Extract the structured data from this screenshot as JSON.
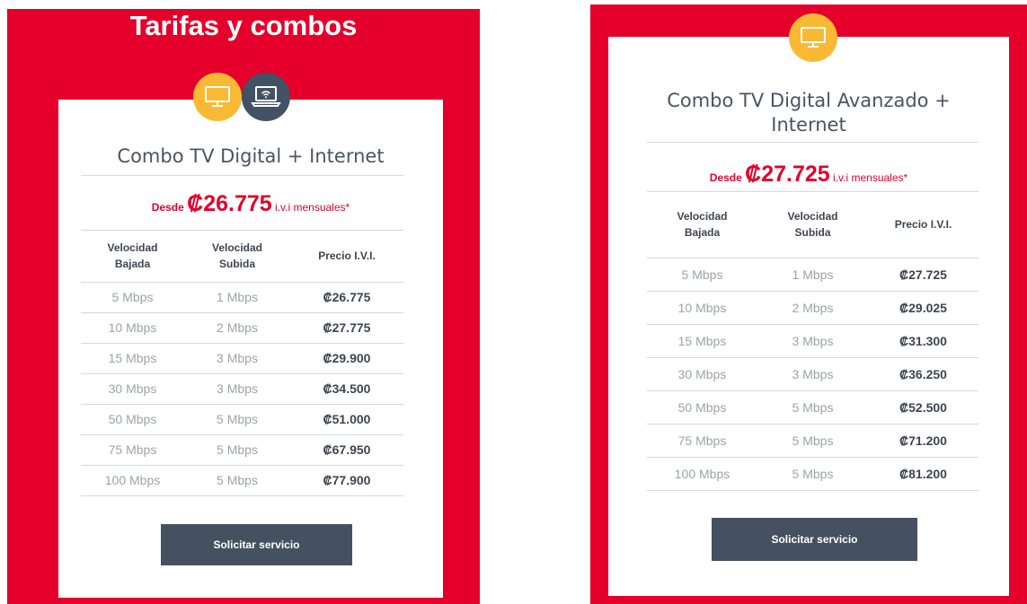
{
  "left": {
    "heading": "Tarifas y combos",
    "icons": [
      "tv-icon",
      "laptop-wifi-icon"
    ],
    "title": "Combo TV Digital + Internet",
    "price": {
      "prefix": "Desde",
      "amount": "₡26.775",
      "suffix": "i.v.i mensuales*"
    },
    "headers": {
      "down_1": "Velocidad",
      "down_2": "Bajada",
      "up_1": "Velocidad",
      "up_2": "Subida",
      "price": "Precio I.V.I."
    },
    "rows": [
      {
        "down": "5 Mbps",
        "up": "1 Mbps",
        "price": "₡26.775"
      },
      {
        "down": "10 Mbps",
        "up": "2 Mbps",
        "price": "₡27.775"
      },
      {
        "down": "15 Mbps",
        "up": "3 Mbps",
        "price": "₡29.900"
      },
      {
        "down": "30 Mbps",
        "up": "3 Mbps",
        "price": "₡34.500"
      },
      {
        "down": "50 Mbps",
        "up": "5 Mbps",
        "price": "₡51.000"
      },
      {
        "down": "75 Mbps",
        "up": "5 Mbps",
        "price": "₡67.950"
      },
      {
        "down": "100 Mbps",
        "up": "5 Mbps",
        "price": "₡77.900"
      }
    ],
    "button": "Solicitar servicio"
  },
  "right": {
    "icons": [
      "tv-icon"
    ],
    "title_line1": "Combo TV Digital Avanzado +",
    "title_line2": "Internet",
    "price": {
      "prefix": "Desde",
      "amount": "₡27.725",
      "suffix": "i.v.i mensuales*"
    },
    "headers": {
      "down_1": "Velocidad",
      "down_2": "Bajada",
      "up_1": "Velocidad",
      "up_2": "Subida",
      "price": "Precio I.V.I."
    },
    "rows": [
      {
        "down": "5 Mbps",
        "up": "1 Mbps",
        "price": "₡27.725"
      },
      {
        "down": "10 Mbps",
        "up": "2 Mbps",
        "price": "₡29.025"
      },
      {
        "down": "15 Mbps",
        "up": "3 Mbps",
        "price": "₡31.300"
      },
      {
        "down": "30 Mbps",
        "up": "3 Mbps",
        "price": "₡36.250"
      },
      {
        "down": "50 Mbps",
        "up": "5 Mbps",
        "price": "₡52.500"
      },
      {
        "down": "75 Mbps",
        "up": "5 Mbps",
        "price": "₡71.200"
      },
      {
        "down": "100 Mbps",
        "up": "5 Mbps",
        "price": "₡81.200"
      }
    ],
    "button": "Solicitar servicio"
  },
  "colors": {
    "brand_red": "#e4002b",
    "icon_yellow": "#f9b934",
    "icon_dark": "#435164",
    "button_bg": "#455160"
  }
}
